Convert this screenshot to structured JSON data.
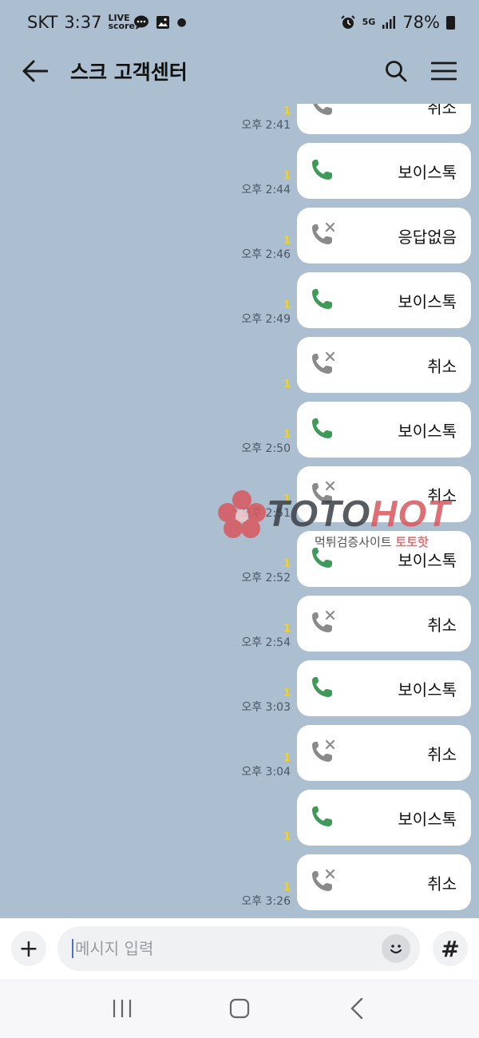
{
  "status_bar": {
    "carrier": "SKT",
    "time": "3:37",
    "live_icon_text": "LIVE score",
    "network": "5G",
    "battery": "78%"
  },
  "header": {
    "title": "스크 고객센터"
  },
  "messages": [
    {
      "type": "missed",
      "label": "취소",
      "unread": "1",
      "time": "오후 2:41"
    },
    {
      "type": "voice",
      "label": "보이스톡",
      "unread": "1",
      "time": "오후 2:44"
    },
    {
      "type": "missed",
      "label": "응답없음",
      "unread": "1",
      "time": "오후 2:46"
    },
    {
      "type": "voice",
      "label": "보이스톡",
      "unread": "1",
      "time": "오후 2:49"
    },
    {
      "type": "missed",
      "label": "취소",
      "unread": "1",
      "time": ""
    },
    {
      "type": "voice",
      "label": "보이스톡",
      "unread": "1",
      "time": "오후 2:50"
    },
    {
      "type": "missed",
      "label": "취소",
      "unread": "1",
      "time": "오후 2:51"
    },
    {
      "type": "voice",
      "label": "보이스톡",
      "unread": "1",
      "time": "오후 2:52"
    },
    {
      "type": "missed",
      "label": "취소",
      "unread": "1",
      "time": "오후 2:54"
    },
    {
      "type": "voice",
      "label": "보이스톡",
      "unread": "1",
      "time": "오후 3:03"
    },
    {
      "type": "missed",
      "label": "취소",
      "unread": "1",
      "time": "오후 3:04"
    },
    {
      "type": "voice",
      "label": "보이스톡",
      "unread": "1",
      "time": ""
    },
    {
      "type": "missed",
      "label": "취소",
      "unread": "1",
      "time": "오후 3:26"
    }
  ],
  "watermark": {
    "brand_part1": "TOTO",
    "brand_part2": "HOT",
    "subtitle": "먹튀검증사이트",
    "subtitle_accent": "토토핫"
  },
  "input": {
    "placeholder": "메시지 입력",
    "plus_icon": "+",
    "hash_icon": "#"
  },
  "colors": {
    "chat_background": "#acbfd1",
    "voice_call_green": "#3f9a5a",
    "missed_call_gray": "#8a8a8a",
    "unread_yellow": "#f3d21d",
    "watermark_red": "#d9575e"
  }
}
